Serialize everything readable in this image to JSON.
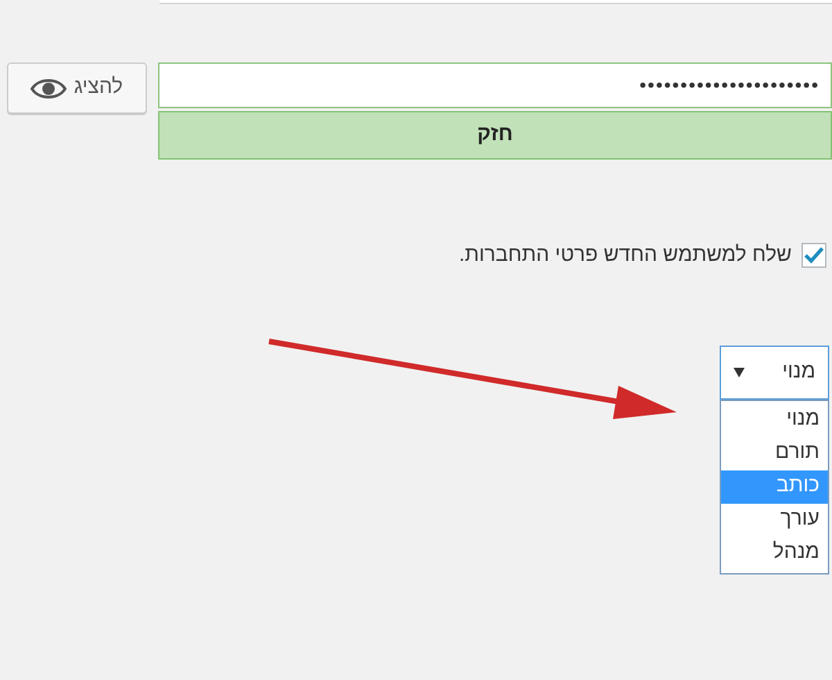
{
  "password": {
    "value": "••••••••••••••••••••••",
    "show_button": {
      "label": "להציג"
    },
    "strength": {
      "label": "חזק",
      "kind": "strong"
    }
  },
  "send_notification": {
    "label": "שלח למשתמש החדש פרטי התחברות.",
    "checked": true
  },
  "role_select": {
    "value": "מנוי",
    "expanded": true,
    "options": [
      {
        "label": "מנוי",
        "highlighted": false
      },
      {
        "label": "תורם",
        "highlighted": false
      },
      {
        "label": "כותב",
        "highlighted": true
      },
      {
        "label": "עורך",
        "highlighted": false
      },
      {
        "label": "מנהל",
        "highlighted": false
      }
    ]
  }
}
